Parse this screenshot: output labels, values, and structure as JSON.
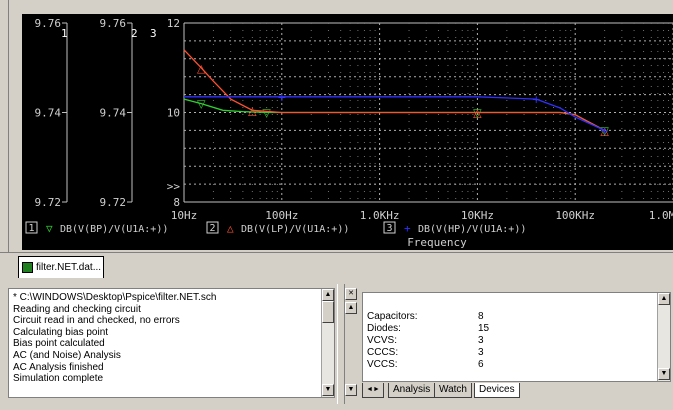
{
  "plot": {
    "axis1_top": "9.76",
    "axis1_mid": "9.74",
    "axis1_bot": "9.72",
    "axis1_num": "1",
    "axis2_top": "9.76",
    "axis2_mid": "9.74",
    "axis2_bot": "9.72",
    "axis2_num": "2",
    "axis3_top": "12",
    "axis3_mid": "10",
    "axis3_bot": "8",
    "axis3_num": "3",
    "axis3_marker": ">>",
    "x_ticks": [
      "10Hz",
      "100Hz",
      "1.0KHz",
      "10KHz",
      "100KHz",
      "1.0M"
    ],
    "x_label": "Frequency",
    "legend": [
      {
        "num": "1",
        "marker": "▽",
        "label": "DB(V(BP)/V(U1A:+))",
        "color": "#30d030"
      },
      {
        "num": "2",
        "marker": "△",
        "label": "DB(V(LP)/V(U1A:+))",
        "color": "#ff5030"
      },
      {
        "num": "3",
        "marker": "+",
        "label": "DB(V(HP)/V(U1A:+))",
        "color": "#3030ff"
      }
    ]
  },
  "chart_data": {
    "type": "line",
    "xlabel": "Frequency",
    "xscale": "log",
    "x_range": [
      10,
      1000000
    ],
    "y_range": [
      8,
      12
    ],
    "series": [
      {
        "name": "DB(V(BP)/V(U1A:+))",
        "x": [
          10,
          15,
          25,
          40,
          70,
          100,
          1000,
          10000,
          70000,
          100000,
          200000
        ],
        "y": [
          10.3,
          10.2,
          10.05,
          10.02,
          10.0,
          10.0,
          10.0,
          10.0,
          10.0,
          9.95,
          9.6
        ]
      },
      {
        "name": "DB(V(LP)/V(U1A:+))",
        "x": [
          10,
          15,
          20,
          30,
          50,
          100,
          1000,
          10000,
          70000,
          100000,
          200000
        ],
        "y": [
          11.4,
          11.0,
          10.7,
          10.3,
          10.05,
          10.0,
          10.0,
          10.0,
          10.0,
          9.95,
          9.6
        ]
      },
      {
        "name": "DB(V(HP)/V(U1A:+))",
        "x": [
          10,
          100,
          1000,
          10000,
          40000,
          70000,
          100000,
          200000
        ],
        "y": [
          10.35,
          10.35,
          10.35,
          10.35,
          10.3,
          10.1,
          9.9,
          9.6
        ]
      }
    ]
  },
  "doc_tab": {
    "label": "filter.NET.dat..."
  },
  "output": {
    "lines": [
      "* C:\\WINDOWS\\Desktop\\Pspice\\filter.NET.sch",
      "Reading and checking circuit",
      "Circuit read in and checked, no errors",
      "Calculating bias point",
      "Bias point calculated",
      "AC (and Noise) Analysis",
      "AC Analysis finished",
      "Simulation complete"
    ]
  },
  "devices": {
    "rows": [
      {
        "name": "Capacitors:",
        "value": "8"
      },
      {
        "name": "Diodes:",
        "value": "15"
      },
      {
        "name": "VCVS:",
        "value": "3"
      },
      {
        "name": "CCCS:",
        "value": "3"
      },
      {
        "name": "VCCS:",
        "value": "6"
      }
    ]
  },
  "tabs": {
    "analysis": "Analysis",
    "watch": "Watch",
    "devices": "Devices"
  }
}
